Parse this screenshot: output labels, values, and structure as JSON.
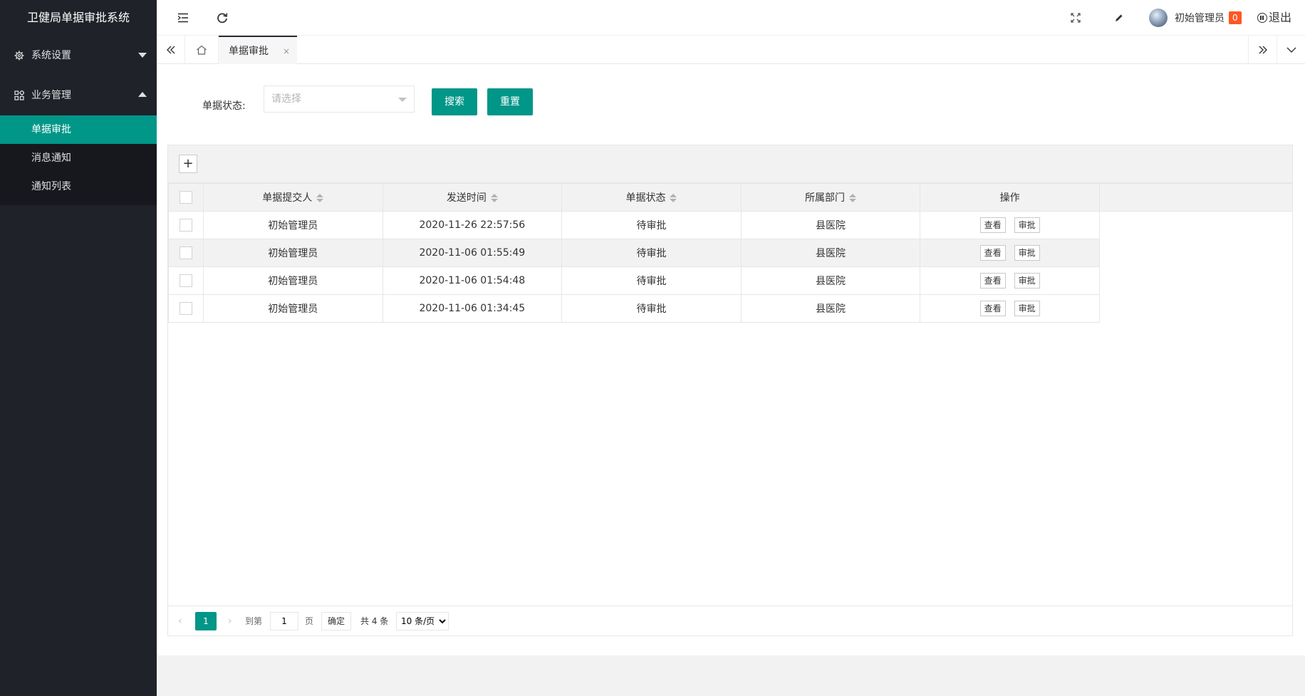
{
  "app": {
    "title": "卫健局单据审批系统"
  },
  "sidebar": {
    "menus": [
      {
        "label": "系统设置",
        "icon": "gear-icon"
      },
      {
        "label": "业务管理",
        "icon": "apps-icon"
      }
    ],
    "sub_items": [
      {
        "label": "单据审批",
        "active": true
      },
      {
        "label": "消息通知",
        "active": false
      },
      {
        "label": "通知列表",
        "active": false
      }
    ]
  },
  "header": {
    "user_name": "初始管理员",
    "message_count": "0",
    "logout_label": "退出"
  },
  "tabs": [
    {
      "label": "单据审批",
      "close": "×"
    }
  ],
  "filter": {
    "status_label": "单据状态:",
    "status_placeholder": "请选择",
    "search_label": "搜索",
    "reset_label": "重置"
  },
  "table": {
    "toolbar_add": "+",
    "columns": [
      "单据提交人",
      "发送时间",
      "单据状态",
      "所属部门",
      "操作"
    ],
    "rows": [
      {
        "submitter": "初始管理员",
        "time": "2020-11-26 22:57:56",
        "status": "待审批",
        "dept": "县医院"
      },
      {
        "submitter": "初始管理员",
        "time": "2020-11-06 01:55:49",
        "status": "待审批",
        "dept": "县医院"
      },
      {
        "submitter": "初始管理员",
        "time": "2020-11-06 01:54:48",
        "status": "待审批",
        "dept": "县医院"
      },
      {
        "submitter": "初始管理员",
        "time": "2020-11-06 01:34:45",
        "status": "待审批",
        "dept": "县医院"
      }
    ],
    "actions": {
      "view": "查看",
      "approve": "审批"
    }
  },
  "pager": {
    "current_page": "1",
    "goto_label": "到第",
    "goto_value": "1",
    "page_unit": "页",
    "confirm_label": "确定",
    "total_label": "共 4 条",
    "page_size": "10 条/页"
  },
  "colors": {
    "accent": "#009688",
    "sidebar_bg": "#20222a",
    "badge": "#ff5722"
  }
}
